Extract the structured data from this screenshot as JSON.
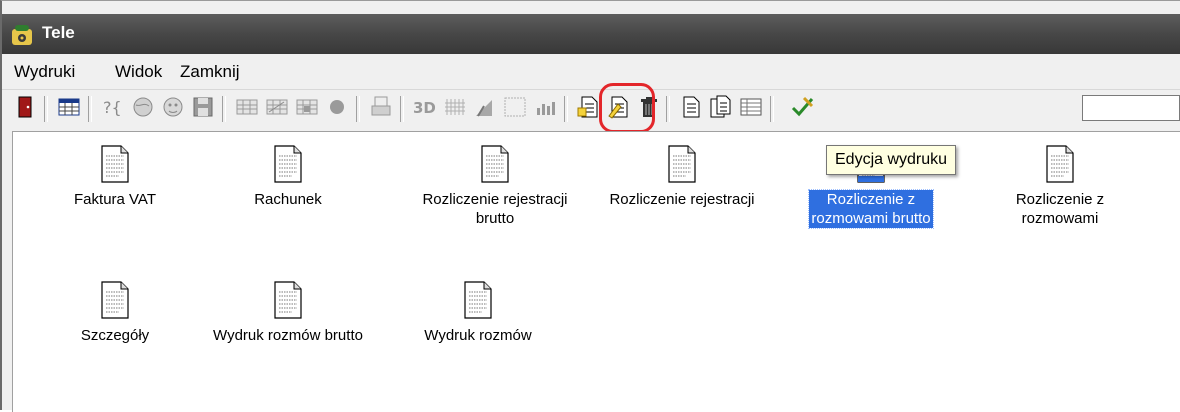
{
  "window": {
    "title": "Tele"
  },
  "menu": [
    "Wydruki",
    "Widok",
    "Zamknij"
  ],
  "toolbar": {
    "buttons": [
      {
        "name": "exit-door-icon"
      },
      {
        "name": "table-icon"
      },
      {
        "name": "help-query-icon"
      },
      {
        "name": "globe-icon"
      },
      {
        "name": "face-icon"
      },
      {
        "name": "save-disk-icon"
      },
      {
        "name": "grid-a-icon"
      },
      {
        "name": "grid-b-icon"
      },
      {
        "name": "grid-c-icon"
      },
      {
        "name": "circle-icon"
      },
      {
        "name": "print-icon"
      },
      {
        "name": "3d-icon"
      },
      {
        "name": "chart-grid-icon"
      },
      {
        "name": "chart-pie-icon"
      },
      {
        "name": "chart-empty-icon"
      },
      {
        "name": "chart-bars-icon"
      },
      {
        "name": "new-document-icon"
      },
      {
        "name": "edit-document-icon"
      },
      {
        "name": "trash-icon"
      },
      {
        "name": "document-icon"
      },
      {
        "name": "documents-icon"
      },
      {
        "name": "list-view-icon"
      },
      {
        "name": "check-pen-icon"
      }
    ]
  },
  "tooltip": "Edycja wydruku",
  "items": [
    {
      "label_lines": [
        "Faktura VAT"
      ],
      "selected": false
    },
    {
      "label_lines": [
        "Rachunek"
      ],
      "selected": false
    },
    {
      "label_lines": [
        "Rozliczenie rejestracji",
        "brutto"
      ],
      "selected": false
    },
    {
      "label_lines": [
        "Rozliczenie rejestracji"
      ],
      "selected": false
    },
    {
      "label_lines": [
        "Rozliczenie z",
        "rozmowami brutto"
      ],
      "selected": true
    },
    {
      "label_lines": [
        "Rozliczenie z",
        "rozmowami"
      ],
      "selected": false
    },
    {
      "label_lines": [
        "Szczegóły"
      ],
      "selected": false
    },
    {
      "label_lines": [
        "Wydruk rozmów brutto"
      ],
      "selected": false
    },
    {
      "label_lines": [
        "Wydruk rozmów"
      ],
      "selected": false
    }
  ],
  "colors": {
    "selection": "#2f6fe0",
    "highlight_ring": "#e3262a",
    "titlebar": "#474747"
  }
}
